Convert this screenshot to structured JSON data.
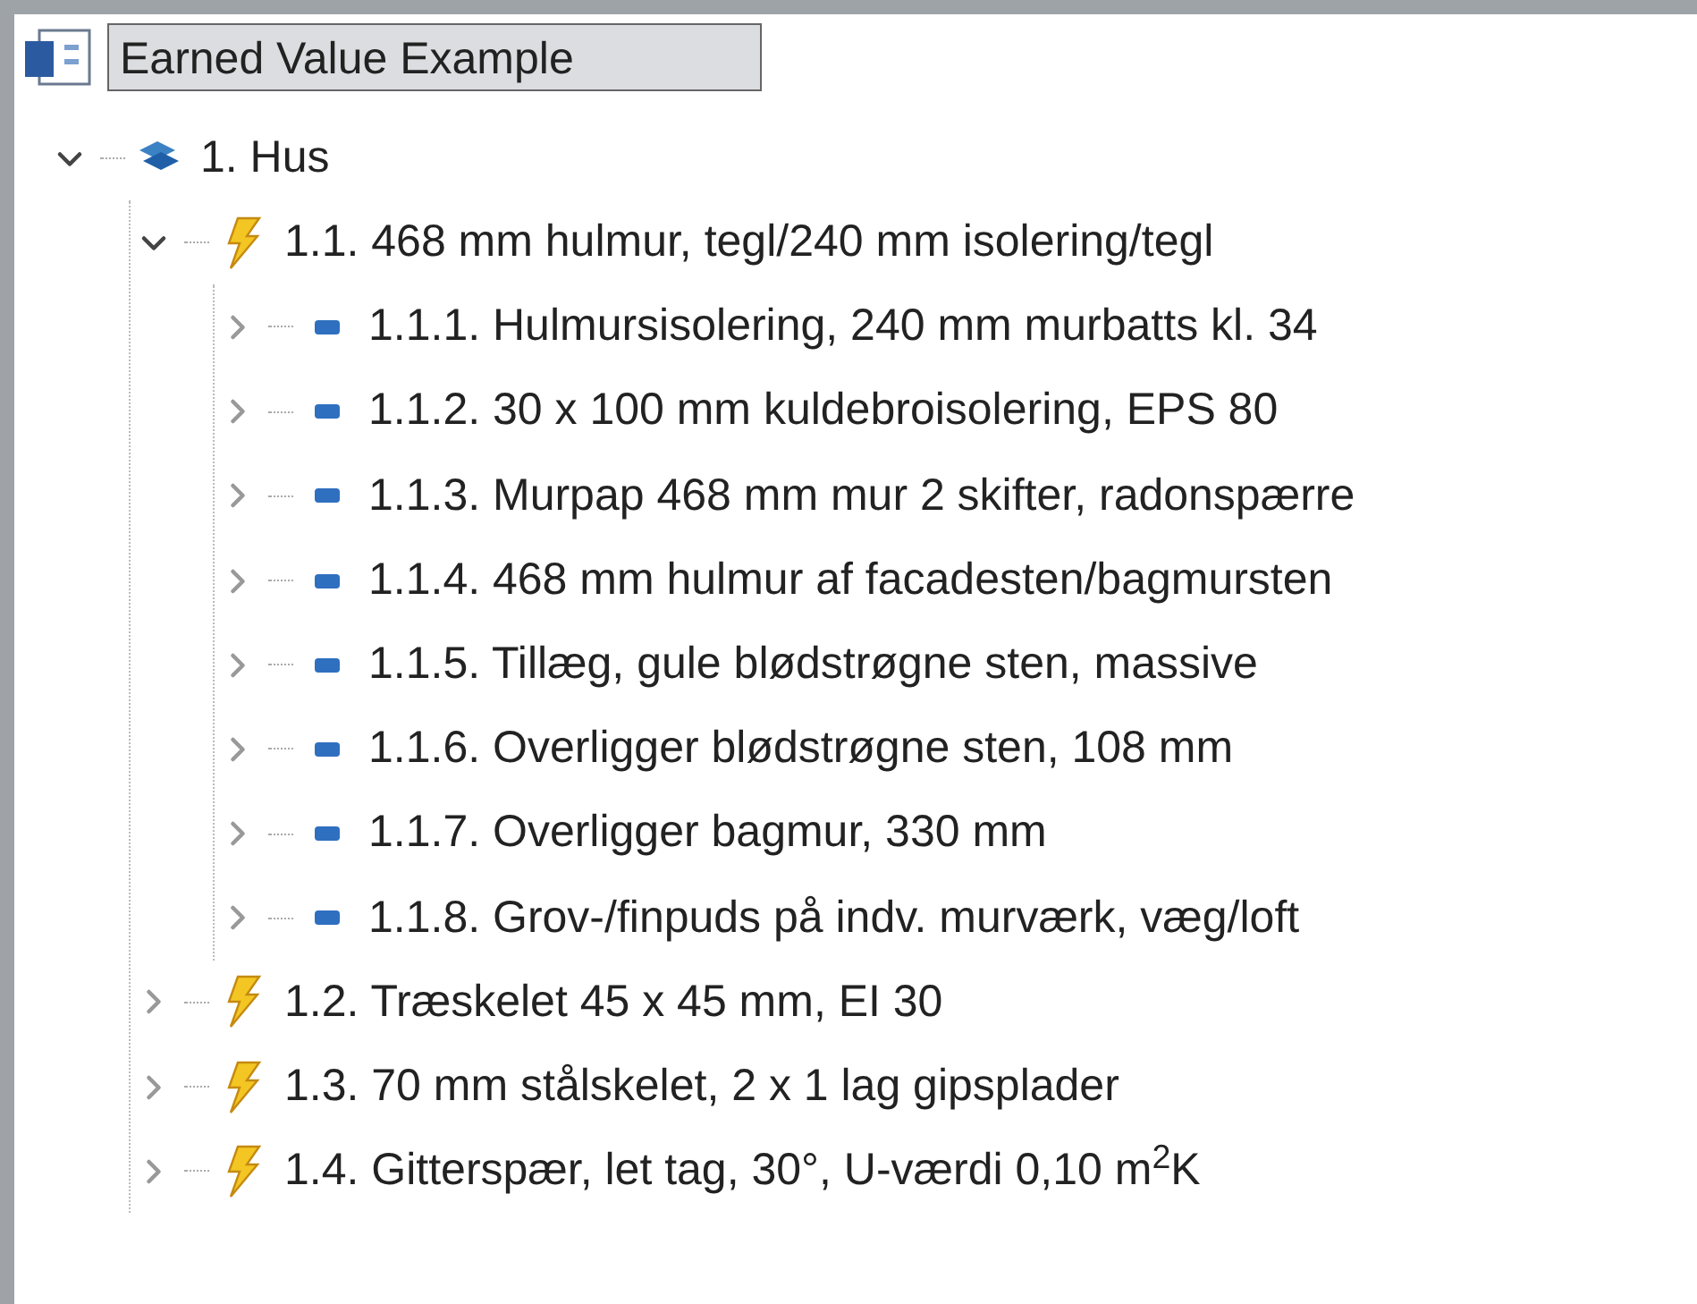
{
  "tree": {
    "label": "Earned Value Example",
    "selected": true,
    "children": [
      {
        "label": "1. Hus",
        "kind": "group",
        "expanded": true,
        "children": [
          {
            "label": "1.1. 468 mm hulmur, tegl/240 mm isolering/tegl",
            "kind": "task",
            "expanded": true,
            "children": [
              {
                "label": "1.1.1. Hulmursisolering, 240 mm murbatts kl. 34",
                "kind": "item",
                "expanded": false
              },
              {
                "label": "1.1.2. 30 x 100 mm kuldebroisolering, EPS 80",
                "kind": "item",
                "expanded": false
              },
              {
                "label": "1.1.3. Murpap 468 mm mur 2 skifter, radonspærre",
                "kind": "item",
                "expanded": false
              },
              {
                "label": "1.1.4. 468 mm hulmur af facadesten/bagmursten",
                "kind": "item",
                "expanded": false
              },
              {
                "label": "1.1.5. Tillæg, gule blødstrøgne sten, massive",
                "kind": "item",
                "expanded": false
              },
              {
                "label": "1.1.6. Overligger blødstrøgne sten, 108 mm",
                "kind": "item",
                "expanded": false
              },
              {
                "label": "1.1.7. Overligger bagmur, 330 mm",
                "kind": "item",
                "expanded": false
              },
              {
                "label": "1.1.8. Grov-/finpuds på indv. murværk, væg/loft",
                "kind": "item",
                "expanded": false
              }
            ]
          },
          {
            "label": "1.2. Træskelet 45 x 45 mm, EI 30",
            "kind": "task",
            "expanded": false
          },
          {
            "label": "1.3. 70 mm stålskelet, 2 x 1 lag gipsplader",
            "kind": "task",
            "expanded": false
          },
          {
            "label": "1.4. Gitterspær, let tag, 30°, U-værdi 0,10 m$^{2}$K",
            "kind": "task",
            "expanded": false
          }
        ]
      }
    ]
  }
}
